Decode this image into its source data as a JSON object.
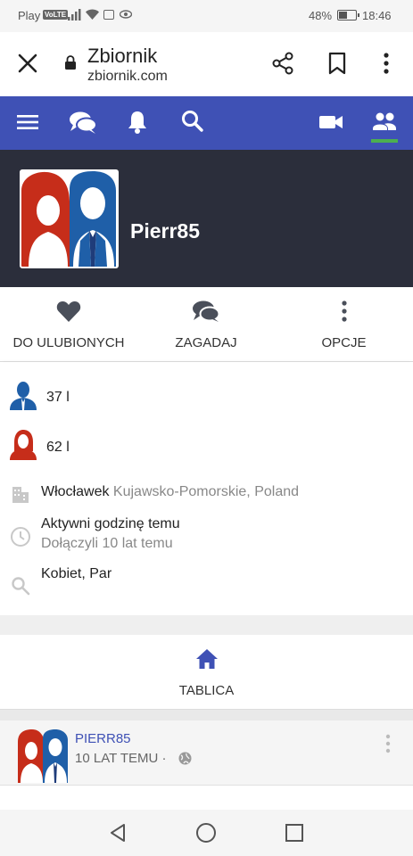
{
  "status_bar": {
    "carrier": "Play",
    "volte": "VoLTE",
    "battery_percent": "48%",
    "battery_level": 0.48,
    "time": "18:46"
  },
  "browser": {
    "page_title": "Zbiornik",
    "url": "zbiornik.com",
    "icons": [
      "close-icon",
      "lock-icon",
      "share-icon",
      "bookmark-icon",
      "more-vert-icon"
    ]
  },
  "nav": {
    "accent_color": "#3f51b5",
    "active_indicator_color": "#4caf50",
    "icons": [
      "menu-icon",
      "chat-icon",
      "bell-icon",
      "search-icon",
      "video-icon",
      "people-icon"
    ]
  },
  "profile": {
    "username": "Pierr85",
    "actions": [
      {
        "label": "DO ULUBIONYCH",
        "icon": "heart-icon"
      },
      {
        "label": "ZAGADAJ",
        "icon": "chat-icon"
      },
      {
        "label": "OPCJE",
        "icon": "more-vert-icon"
      }
    ],
    "male_age": "37 l",
    "female_age": "62 l",
    "city": "Włocławek",
    "region": "Kujawsko-Pomorskie, Poland",
    "active": "Aktywni godzinę temu",
    "joined": "Dołączyli 10 lat temu",
    "looking_for": "Kobiet, Par"
  },
  "tabs": {
    "active_tab": "TABLICA"
  },
  "post": {
    "author": "PIERR85",
    "time": "10 LAT TEMU ·"
  },
  "system_nav": [
    "back-icon",
    "home-circle-icon",
    "recents-icon"
  ]
}
